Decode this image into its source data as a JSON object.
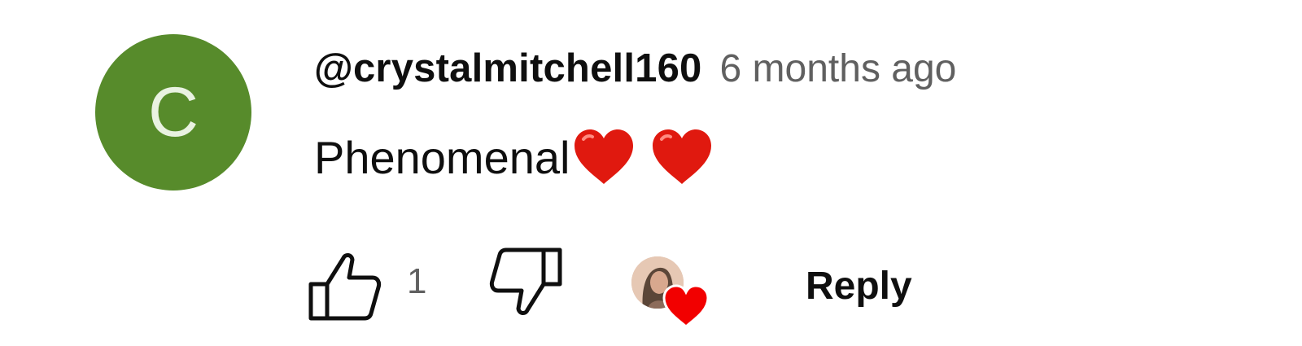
{
  "comment": {
    "avatar_letter": "C",
    "avatar_color": "#578b2b",
    "author": "@crystalmitchell160",
    "time": "6 months ago",
    "text": "Phenomenal",
    "emojis": [
      "red-heart-icon",
      "red-heart-icon"
    ],
    "emoji_color": "#e0190f"
  },
  "actions": {
    "like_icon": "thumb-up-icon",
    "like_count": "1",
    "dislike_icon": "thumb-down-icon",
    "creator_heart_icon": "heart-icon",
    "reply_label": "Reply"
  }
}
